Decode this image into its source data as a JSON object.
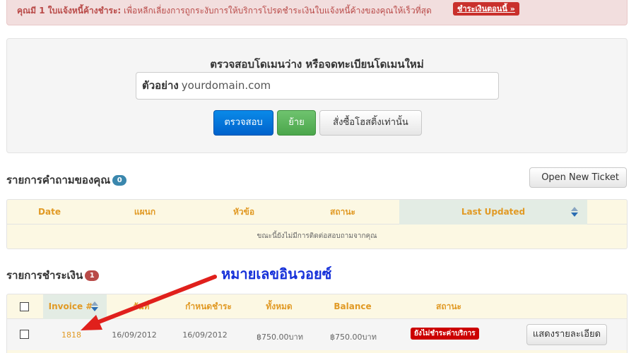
{
  "alert": {
    "prefix": "คุณมี 1 ใบแจ้งหนี้ค้างชำระ:",
    "message": " เพื่อหลีกเลี่ยงการถูกระงับการให้บริการโปรดชำระเงินใบแจ้งหนี้ค้างของคุณให้เร็วที่สุด",
    "pay_button": "ชำระเงินตอนนี้ »"
  },
  "domain_search": {
    "title": "ตรวจสอบโดเมนว่าง หรือจดทะเบียนโดเมนใหม่",
    "input_label": "ตัวอย่าง",
    "input_placeholder": "yourdomain.com",
    "check_button": "ตรวจสอบ",
    "transfer_button": "ย้าย",
    "hosting_button": "สั่งซื้อโฮสติ้งเท่านั้น"
  },
  "tickets": {
    "title": "รายการคำถามของคุณ",
    "count": "0",
    "open_button": "Open New Ticket",
    "columns": [
      "Date",
      "แผนก",
      "หัวข้อ",
      "สถานะ",
      "Last Updated"
    ],
    "empty_message": "ขณะนี้ยังไม่มีการติดต่อสอบถามจากคุณ"
  },
  "invoices": {
    "title": "รายการชำระเงิน",
    "count": "1",
    "columns": [
      "Invoice #",
      "วันที่",
      "กำหนดชำระ",
      "ทั้งหมด",
      "Balance",
      "สถานะ"
    ],
    "rows": [
      {
        "number": "1818",
        "date": "16/09/2012",
        "due": "16/09/2012",
        "total": "฿750.00บาท",
        "balance": "฿750.00บาท",
        "status": "ยังไม่ชำระค่าบริการ",
        "action": "แสดงรายละเอียด"
      }
    ]
  },
  "annotation": {
    "label": "หมายเลขอินวอยซ์",
    "color": "#1530d9",
    "arrow_color": "#e0201c"
  }
}
